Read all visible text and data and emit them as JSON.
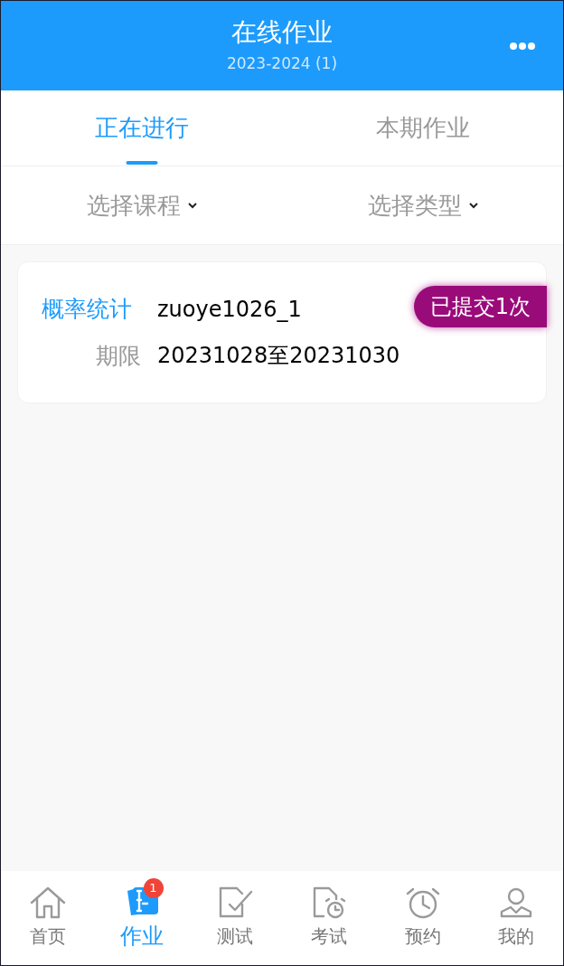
{
  "header": {
    "title": "在线作业",
    "subtitle": "2023-2024 (1)"
  },
  "tabs": [
    {
      "label": "正在进行",
      "selected": true
    },
    {
      "label": "本期作业",
      "selected": false
    }
  ],
  "filters": [
    {
      "label": "选择课程"
    },
    {
      "label": "选择类型"
    }
  ],
  "assignments": [
    {
      "course": "概率统计",
      "name": "zuoye1026_1",
      "status": "已提交1次",
      "deadline_label": "期限",
      "deadline": "20231028至20231030"
    }
  ],
  "nav": [
    {
      "kind": "home",
      "label": "首页",
      "selected": false
    },
    {
      "kind": "homework",
      "label": "作业",
      "selected": true,
      "badge": "1"
    },
    {
      "kind": "test",
      "label": "测试",
      "selected": false
    },
    {
      "kind": "exam",
      "label": "考试",
      "selected": false
    },
    {
      "kind": "booking",
      "label": "预约",
      "selected": false
    },
    {
      "kind": "profile",
      "label": "我的",
      "selected": false
    }
  ]
}
